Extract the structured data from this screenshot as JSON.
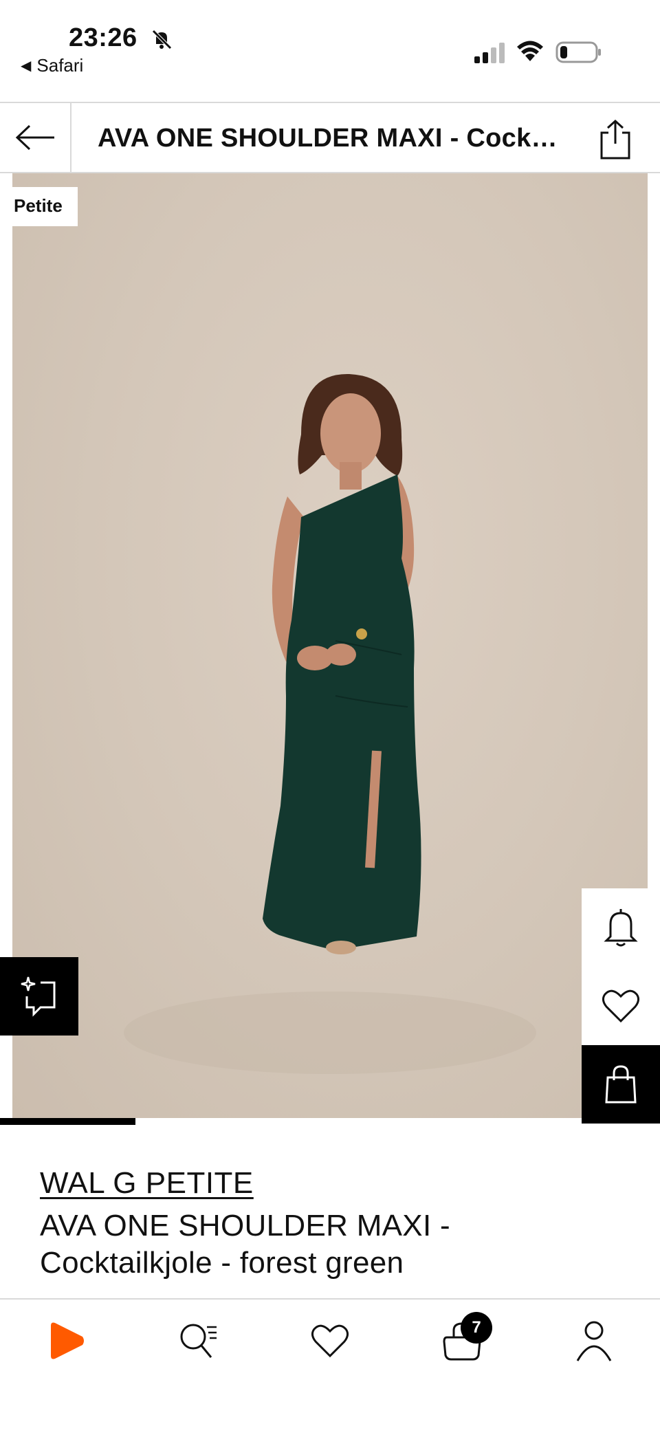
{
  "status_bar": {
    "time": "23:26",
    "back_app": "Safari",
    "icons": [
      "bell-muted-icon",
      "cellular-signal-icon",
      "wifi-icon",
      "battery-low-icon"
    ]
  },
  "header": {
    "title": "AVA ONE SHOULDER MAXI - Cocktailkjole - forest green",
    "icons": [
      "back-arrow-icon",
      "share-icon"
    ]
  },
  "gallery": {
    "badge": "Petite",
    "image_alt": "Model wearing forest green one shoulder maxi dress",
    "progress": 0.25,
    "actions": [
      "sparkle-comment-icon",
      "bell-icon",
      "heart-icon",
      "shopping-bag-icon"
    ]
  },
  "product": {
    "brand": "WAL G PETITE",
    "name": "AVA ONE SHOULDER MAXI - Cocktailkjole - forest green"
  },
  "tab_bar": {
    "items": [
      "home-icon",
      "search-icon",
      "wishlist-icon",
      "cart-icon",
      "account-icon"
    ],
    "cart_count": "7",
    "accent": "#ff5a00"
  },
  "colors": {
    "dress": "#13382f",
    "backdrop": "#d4c7b9",
    "accent": "#ff5a00"
  }
}
